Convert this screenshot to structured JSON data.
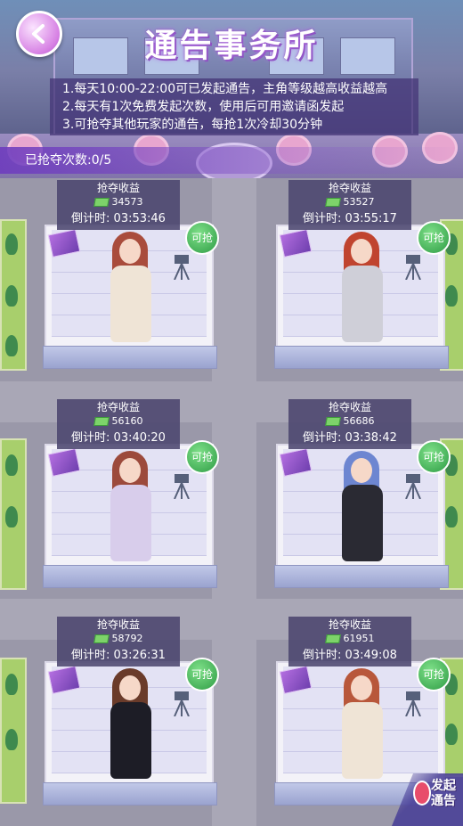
{
  "header": {
    "title": "通告事务所"
  },
  "rules": [
    "1.每天10:00-22:00可已发起通告，主角等级越高收益越高",
    "2.每天有1次免费发起次数，使用后可用邀请函发起",
    "3.可抢夺其他玩家的通告，每抢1次冷却30分钟"
  ],
  "grab_count": "已抢夺次数:0/5",
  "cards": [
    {
      "label": "抢夺收益",
      "amount": "34573",
      "countdown": "倒计时: 03:53:46",
      "badge": "可抢",
      "outfit": "#efe4d6",
      "hair": "#a94c3c"
    },
    {
      "label": "抢夺收益",
      "amount": "53527",
      "countdown": "倒计时: 03:55:17",
      "badge": "可抢",
      "outfit": "#cfcfd8",
      "hair": "#c0442f"
    },
    {
      "label": "抢夺收益",
      "amount": "56160",
      "countdown": "倒计时: 03:40:20",
      "badge": "可抢",
      "outfit": "#d8cdeb",
      "hair": "#9c4a3c"
    },
    {
      "label": "抢夺收益",
      "amount": "56686",
      "countdown": "倒计时: 03:38:42",
      "badge": "可抢",
      "outfit": "#2a2a33",
      "hair": "#6d86d1"
    },
    {
      "label": "抢夺收益",
      "amount": "58792",
      "countdown": "倒计时: 03:26:31",
      "badge": "可抢",
      "outfit": "#1d1d26",
      "hair": "#6a3b2a"
    },
    {
      "label": "抢夺收益",
      "amount": "61951",
      "countdown": "倒计时: 03:49:08",
      "badge": "可抢",
      "outfit": "#efe4d6",
      "hair": "#b8573b"
    }
  ],
  "launch_button": {
    "line1": "发起",
    "line2": "通告"
  },
  "colors": {
    "accent": "#7a4fc8",
    "badge_green": "#2e9c45"
  }
}
